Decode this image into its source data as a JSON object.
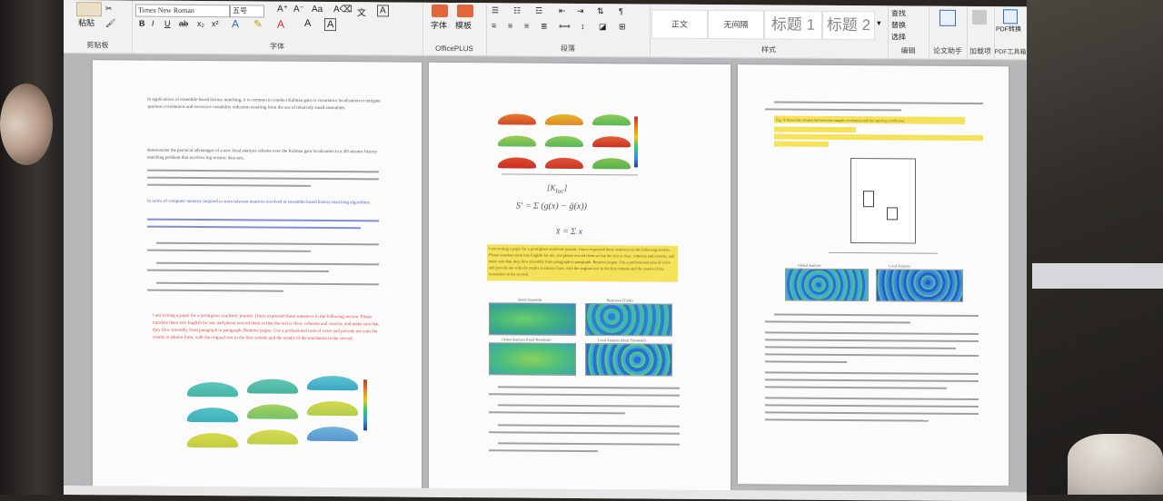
{
  "ribbon": {
    "clipboard": {
      "paste_label": "粘贴",
      "group_label": "剪贴板"
    },
    "font": {
      "font_name": "Times New Roman",
      "font_size": "五号",
      "group_label": "字体"
    },
    "officeplus": {
      "font_label": "字体",
      "template_label": "模板",
      "group_label": "OfficePLUS"
    },
    "paragraph": {
      "group_label": "段落"
    },
    "styles": {
      "group_label": "样式",
      "items": [
        "正文",
        "无间隔",
        "标题 1",
        "标题 2"
      ]
    },
    "editing": {
      "group_label": "编辑",
      "items": [
        "查找",
        "替换",
        "选择"
      ]
    },
    "lunwen": {
      "label": "论文助手"
    },
    "addin": {
      "label": "加载项"
    },
    "pdf": {
      "button_label": "PDF转换",
      "group_label": "PDF工具箱"
    }
  },
  "page1": {
    "para1": "In applications of ensemble-based history matching, it is common to conduct Kalman gain or covariance localization to mitigate spurious correlations and excessive variability reduction resulting from the use of relatively small ensembles.",
    "para2": "demonstrate the practical advantages of a new local analysis scheme over the Kalman gain localization in a 4D seismic history matching problem that involves big seismic data sets.",
    "blue": "In terms of computer memory required to store relevant matrices involved in ensemble-based history-matching algorithms.",
    "red": "I am writing a paper for a prestigious academic journal. I have expressed these sentences in the following section. Please translate them into English for me, and please reword them so that the text is clear, coherent and concise, and make sure that they flow smoothly from paragraph to paragraph. Remove jargon. Use a professional tone of voice and provide me with the results in tabular form, with the original text in the first column and the results of the translation in the second."
  },
  "page2": {
    "highlight": "I am writing a paper for a prestigious academic journal. I have expressed these sentences in the following section. Please translate them into English for me, and please reword them so that the text is clear, coherent and concise, and make sure that they flow smoothly from paragraph to paragraph. Remove jargon. Use a professional tone of voice and provide me with the results in tabular form, with the original text in the first column and the results of the translation in the second.",
    "panel_titles": [
      "Initial Ensemble",
      "Reference (Truth)",
      "Global Analysis (Hard Threshold)",
      "Local Analysis (Hard Threshold)"
    ]
  },
  "page3": {
    "highlight": "Fig. 8 shows the relation between the sample correlation and the tapering coefficient.",
    "panel_titles": [
      "Global Analysis",
      "Local Analysis"
    ]
  },
  "colors": {
    "highlight": "#f5e25a",
    "blue_text": "#4a5fc6",
    "red_text": "#d94646"
  }
}
